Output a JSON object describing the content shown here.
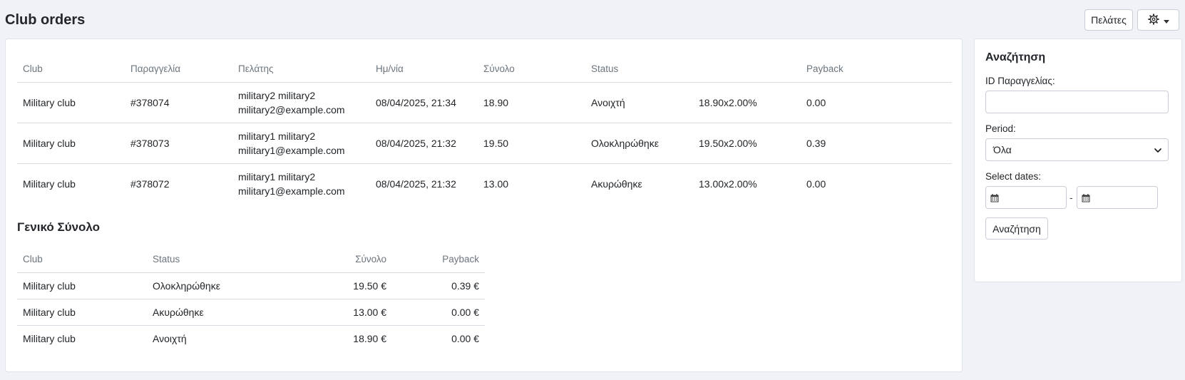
{
  "header": {
    "title": "Club orders",
    "customers_button": "Πελάτες",
    "settings_icon": "gear-icon"
  },
  "orders": {
    "columns": [
      "Club",
      "Παραγγελία",
      "Πελάτης",
      "Ημ/νία",
      "Σύνολο",
      "Status",
      "",
      "Payback"
    ],
    "rows": [
      {
        "club": "Military club",
        "order": "#378074",
        "customer_name": "military2 military2",
        "customer_email": "military2@example.com",
        "date": "08/04/2025, 21:34",
        "total": "18.90",
        "status": "Ανοιχτή",
        "calc": "18.90x2.00%",
        "payback": "0.00"
      },
      {
        "club": "Military club",
        "order": "#378073",
        "customer_name": "military1 military2",
        "customer_email": "military1@example.com",
        "date": "08/04/2025, 21:32",
        "total": "19.50",
        "status": "Ολοκληρώθηκε",
        "calc": "19.50x2.00%",
        "payback": "0.39"
      },
      {
        "club": "Military club",
        "order": "#378072",
        "customer_name": "military1 military2",
        "customer_email": "military1@example.com",
        "date": "08/04/2025, 21:32",
        "total": "13.00",
        "status": "Ακυρώθηκε",
        "calc": "13.00x2.00%",
        "payback": "0.00"
      }
    ]
  },
  "totals": {
    "title": "Γενικό Σύνολο",
    "columns": [
      "Club",
      "Status",
      "Σύνολο",
      "Payback"
    ],
    "rows": [
      {
        "club": "Military club",
        "status": "Ολοκληρώθηκε",
        "total": "19.50 €",
        "payback": "0.39 €"
      },
      {
        "club": "Military club",
        "status": "Ακυρώθηκε",
        "total": "13.00 €",
        "payback": "0.00 €"
      },
      {
        "club": "Military club",
        "status": "Ανοιχτή",
        "total": "18.90 €",
        "payback": "0.00 €"
      }
    ]
  },
  "search": {
    "title": "Αναζήτηση",
    "order_id_label": "ID Παραγγελίας:",
    "order_id_value": "",
    "period_label": "Period:",
    "period_value": "Όλα",
    "dates_label": "Select dates:",
    "date_separator": "-",
    "button": "Αναζήτηση"
  }
}
